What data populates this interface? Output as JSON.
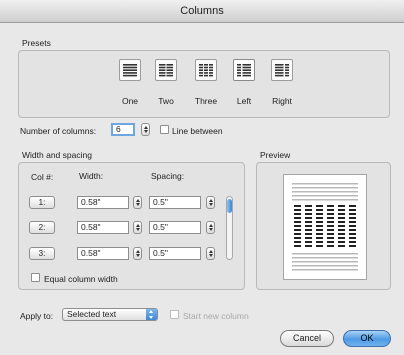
{
  "window": {
    "title": "Columns"
  },
  "presets": {
    "heading": "Presets",
    "items": [
      {
        "label": "One",
        "icon": "one-column-icon"
      },
      {
        "label": "Two",
        "icon": "two-column-icon"
      },
      {
        "label": "Three",
        "icon": "three-column-icon"
      },
      {
        "label": "Left",
        "icon": "left-column-icon"
      },
      {
        "label": "Right",
        "icon": "right-column-icon"
      }
    ]
  },
  "number_of_columns": {
    "label": "Number of columns:",
    "value": "6"
  },
  "line_between": {
    "label": "Line between",
    "checked": false
  },
  "width_spacing": {
    "heading": "Width and spacing",
    "col_header": "Col #:",
    "width_header": "Width:",
    "spacing_header": "Spacing:",
    "rows": [
      {
        "col": "1:",
        "width": "0.58\"",
        "spacing": "0.5\""
      },
      {
        "col": "2:",
        "width": "0.58\"",
        "spacing": "0.5\""
      },
      {
        "col": "3:",
        "width": "0.58\"",
        "spacing": "0.5\""
      }
    ],
    "equal_width": {
      "label": "Equal column width",
      "checked": false
    }
  },
  "preview": {
    "heading": "Preview",
    "columns": 6
  },
  "apply_to": {
    "label": "Apply to:",
    "selected": "Selected text"
  },
  "start_new_column": {
    "label": "Start new column",
    "enabled": false
  },
  "buttons": {
    "cancel": "Cancel",
    "ok": "OK"
  }
}
